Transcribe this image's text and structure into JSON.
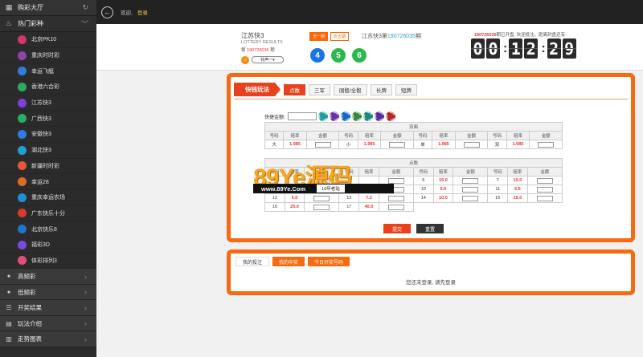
{
  "sidebar": {
    "hall": "购彩大厅",
    "hot": "热门彩种",
    "items": [
      {
        "label": "北京PK10",
        "color": "#d6336c",
        "icon": "pk10"
      },
      {
        "label": "重庆时时彩",
        "color": "#8e44ad",
        "icon": "cqssc"
      },
      {
        "label": "幸运飞艇",
        "color": "#2f7de1",
        "icon": "xyft"
      },
      {
        "label": "香港六合彩",
        "color": "#27ae60",
        "icon": "lhc"
      },
      {
        "label": "江苏快3",
        "color": "#7b3fe4",
        "icon": "jsk3"
      },
      {
        "label": "广西快3",
        "color": "#2bae66",
        "icon": "gxk3"
      },
      {
        "label": "安徽快3",
        "color": "#2d7be5",
        "icon": "ahk3"
      },
      {
        "label": "湖北快3",
        "color": "#1aa1d6",
        "icon": "hbk3"
      },
      {
        "label": "新疆时时彩",
        "color": "#e9553b",
        "icon": "xjssc"
      },
      {
        "label": "幸运28",
        "color": "#e06a1f",
        "icon": "xy28"
      },
      {
        "label": "重庆幸运农场",
        "color": "#1e90d6",
        "icon": "xync"
      },
      {
        "label": "广东快乐十分",
        "color": "#d93a2b",
        "icon": "klsf"
      },
      {
        "label": "北京快乐8",
        "color": "#1c76d2",
        "icon": "kl8"
      },
      {
        "label": "福彩3D",
        "color": "#7a4ae0",
        "icon": "3d"
      },
      {
        "label": "体彩排列3",
        "color": "#e04f7a",
        "icon": "pl3"
      }
    ],
    "sections": [
      {
        "label": "高频彩",
        "icon": "star"
      },
      {
        "label": "低频彩",
        "icon": "star"
      },
      {
        "label": "开奖结果",
        "icon": "list"
      },
      {
        "label": "玩法介绍",
        "icon": "book"
      },
      {
        "label": "走势图表",
        "icon": "chart"
      }
    ]
  },
  "topbar": {
    "welcome": "欢迎,",
    "login": "登录"
  },
  "lottery": {
    "name": "江苏快3",
    "sub": "LOTTERY RESULTS",
    "issue_prefix": "第 ",
    "issue": "190726036",
    "issue_suffix": " 期",
    "sound_option": "铃声一",
    "pill_recent": "近一期",
    "pill_ten": "近五期",
    "current_name": "江苏快3第",
    "current_issue": "190726035",
    "current_suffix": "期",
    "balls": [
      {
        "value": "4",
        "color": "#1a73e8"
      },
      {
        "value": "5",
        "color": "#2db84b"
      },
      {
        "value": "6",
        "color": "#2db84b"
      }
    ],
    "countdown_issue": "190726036",
    "countdown_note": "期已开盘, 欢迎投注。距离封盘还有:",
    "countdown": [
      "0",
      "0",
      "1",
      "2",
      "2",
      "9"
    ]
  },
  "betting": {
    "title": "快钱玩法",
    "tabs": [
      "点数",
      "三军",
      "围骰/全骰",
      "长牌",
      "短牌"
    ],
    "quick_label": "快捷金额:",
    "chip_colors": [
      "#1a9e9e",
      "#6a2fb0",
      "#1466c8",
      "#2f8b3a",
      "#15897a",
      "#5b2a99",
      "#b82525"
    ],
    "dx_title": "双面",
    "col_no": "号码",
    "col_odds": "赔率",
    "col_amt": "金额",
    "dx_rows": [
      [
        {
          "no": "大",
          "odds": "1.985"
        },
        {
          "no": "小",
          "odds": "1.985"
        },
        {
          "no": "单",
          "odds": "1.985"
        },
        {
          "no": "双",
          "odds": "1.985"
        }
      ]
    ],
    "pt_title": "点数",
    "pt_rows": [
      [
        {
          "no": "4",
          "odds": ""
        },
        {
          "no": "5",
          "odds": ""
        },
        {
          "no": "6",
          "odds": "15.0"
        },
        {
          "no": "7",
          "odds": "10.0"
        }
      ],
      [
        {
          "no": "8",
          "odds": ""
        },
        {
          "no": "9",
          "odds": ""
        },
        {
          "no": "10",
          "odds": "5.6"
        },
        {
          "no": "11",
          "odds": "5.6"
        }
      ],
      [
        {
          "no": "12",
          "odds": "6.0"
        },
        {
          "no": "13",
          "odds": "7.2"
        },
        {
          "no": "14",
          "odds": "10.0"
        },
        {
          "no": "15",
          "odds": "15.0"
        }
      ],
      [
        {
          "no": "16",
          "odds": "25.0"
        },
        {
          "no": "17",
          "odds": "40.0"
        }
      ]
    ],
    "submit": "提交",
    "reset": "重置"
  },
  "watermark": {
    "big": "89Ye源码",
    "url": "www.89Ye.Com",
    "tag": "10年老站"
  },
  "records": {
    "tabs": [
      "我的投注",
      "我的中奖",
      "今日开奖号码"
    ],
    "empty": "您还未登录, 请先登录"
  }
}
